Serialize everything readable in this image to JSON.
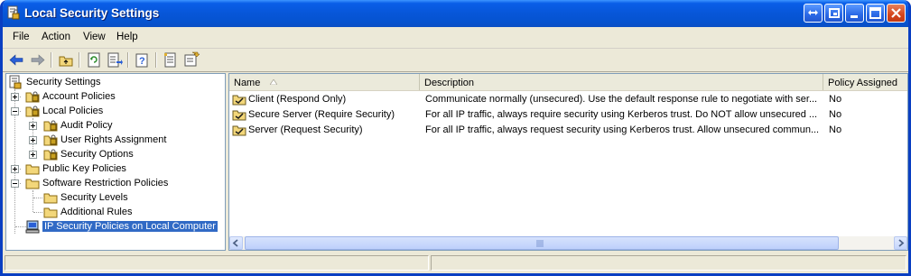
{
  "window": {
    "title": "Local Security Settings"
  },
  "menu": {
    "items": [
      "File",
      "Action",
      "View",
      "Help"
    ]
  },
  "toolbar": {
    "buttons": [
      "back-arrow-icon",
      "forward-arrow-icon",
      "up-one-level-icon",
      "refresh-icon",
      "export-list-icon",
      "help-icon",
      "properties-icon",
      "import-policy-icon"
    ]
  },
  "tree": {
    "nodes": [
      {
        "label": "Security Settings",
        "icon": "security-settings-icon",
        "expander": "none"
      },
      {
        "label": "Account Policies",
        "icon": "locked-folder-icon",
        "expander": "plus"
      },
      {
        "label": "Local Policies",
        "icon": "locked-folder-icon",
        "expander": "minus"
      },
      {
        "label": "Audit Policy",
        "icon": "locked-folder-icon",
        "expander": "plus"
      },
      {
        "label": "User Rights Assignment",
        "icon": "locked-folder-icon",
        "expander": "plus"
      },
      {
        "label": "Security Options",
        "icon": "locked-folder-icon",
        "expander": "plus"
      },
      {
        "label": "Public Key Policies",
        "icon": "folder-icon",
        "expander": "plus"
      },
      {
        "label": "Software Restriction Policies",
        "icon": "folder-icon",
        "expander": "minus"
      },
      {
        "label": "Security Levels",
        "icon": "folder-icon",
        "expander": "none"
      },
      {
        "label": "Additional Rules",
        "icon": "folder-icon",
        "expander": "none"
      },
      {
        "label": "IP Security Policies on Local Computer",
        "icon": "computer-icon",
        "expander": "none",
        "selected": true
      }
    ]
  },
  "list": {
    "columns": [
      "Name",
      "Description",
      "Policy Assigned"
    ],
    "sort_indicator": "ascending",
    "rows": [
      {
        "name": "Client (Respond Only)",
        "description": "Communicate normally (unsecured). Use the default response rule to negotiate with ser...",
        "assigned": "No"
      },
      {
        "name": "Secure Server (Require Security)",
        "description": "For all IP traffic, always require security using Kerberos trust. Do NOT allow unsecured ...",
        "assigned": "No"
      },
      {
        "name": "Server (Request Security)",
        "description": "For all IP traffic, always request security using Kerberos trust. Allow unsecured commun...",
        "assigned": "No"
      }
    ]
  },
  "colors": {
    "titlebar": "#0653d0",
    "selection": "#316ac5",
    "window_bg": "#ece9d8"
  }
}
